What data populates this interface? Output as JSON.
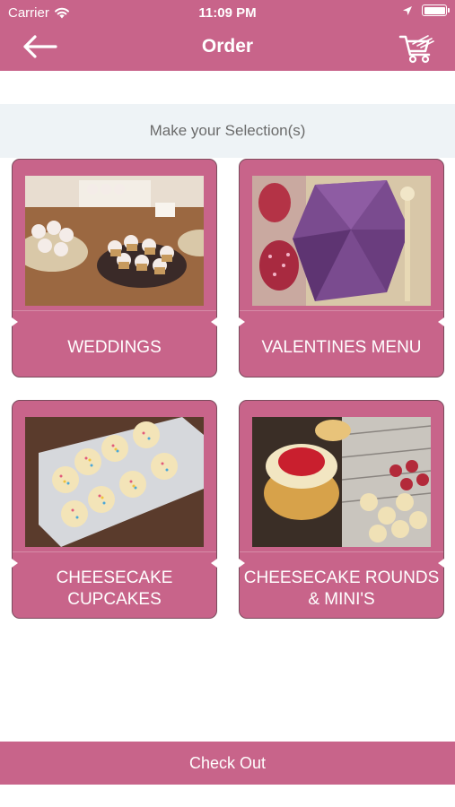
{
  "status_bar": {
    "carrier": "Carrier",
    "time": "11:09 PM"
  },
  "nav": {
    "title": "Order",
    "back_icon": "arrow-left-icon",
    "cart_icon": "shopping-cart-icon"
  },
  "prompt": "Make your Selection(s)",
  "categories": [
    {
      "label": "WEDDINGS"
    },
    {
      "label": "VALENTINES MENU"
    },
    {
      "label": "CHEESECAKE CUPCAKES"
    },
    {
      "label": "CHEESECAKE ROUNDS & MINI'S"
    }
  ],
  "checkout_label": "Check Out",
  "colors": {
    "brand": "#c8648a",
    "prompt_bg": "#eef3f6"
  }
}
